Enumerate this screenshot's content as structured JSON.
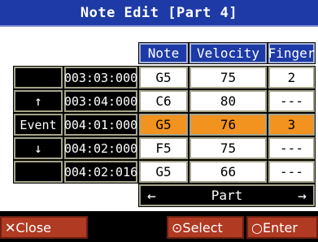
{
  "title": "Note Edit [Part 4]",
  "columns": {
    "note": "Note",
    "velocity": "Velocity",
    "finger": "Finger"
  },
  "left_labels": {
    "up": "↑",
    "event": "Event",
    "down": "↓"
  },
  "rows": [
    {
      "time": "003:03:000",
      "note": "G5",
      "velocity": "75",
      "finger": "2"
    },
    {
      "time": "003:04:000",
      "note": "C6",
      "velocity": "80",
      "finger": "---"
    },
    {
      "time": "004:01:000",
      "note": "G5",
      "velocity": "76",
      "finger": "3"
    },
    {
      "time": "004:02:000",
      "note": "F5",
      "velocity": "75",
      "finger": "---"
    },
    {
      "time": "004:02:016",
      "note": "G5",
      "velocity": "66",
      "finger": "---"
    }
  ],
  "selected_row": 2,
  "part_nav": {
    "label": "Part",
    "left": "←",
    "right": "→"
  },
  "buttons": {
    "close": "✕Close",
    "select": "⊙Select",
    "enter": "○Enter"
  },
  "colors": {
    "title_bg": "#1d3aa6",
    "highlight": "#f2921f",
    "button_bg": "#b03a22"
  }
}
